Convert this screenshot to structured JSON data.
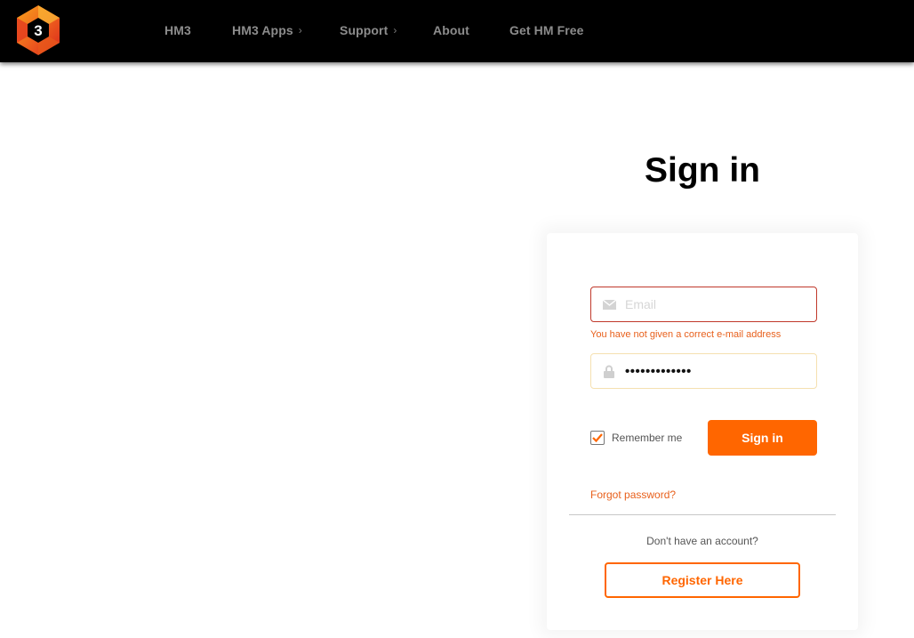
{
  "navbar": {
    "logo_text": "3",
    "items": [
      {
        "label": "HM3",
        "has_submenu": false
      },
      {
        "label": "HM3 Apps",
        "has_submenu": true
      },
      {
        "label": "Support",
        "has_submenu": true
      },
      {
        "label": "About",
        "has_submenu": false
      },
      {
        "label": "Get HM Free",
        "has_submenu": false
      }
    ],
    "chevron": "›"
  },
  "page": {
    "title": "Sign in"
  },
  "form": {
    "email": {
      "placeholder": "Email",
      "value": "",
      "icon": "envelope-icon",
      "error": "You have not given a correct e-mail address"
    },
    "password": {
      "value_masked": "•••••••••••••",
      "icon": "lock-icon"
    },
    "remember_me": {
      "label": "Remember me",
      "checked": true
    },
    "signin_label": "Sign in",
    "forgot_label": "Forgot password?",
    "no_account_text": "Don't have an account?",
    "register_label": "Register Here"
  },
  "colors": {
    "accent": "#ff6600",
    "error": "#e8601c",
    "error_border": "#c0392b",
    "navbar_bg": "#000000",
    "nav_text": "#8c8c8c"
  }
}
